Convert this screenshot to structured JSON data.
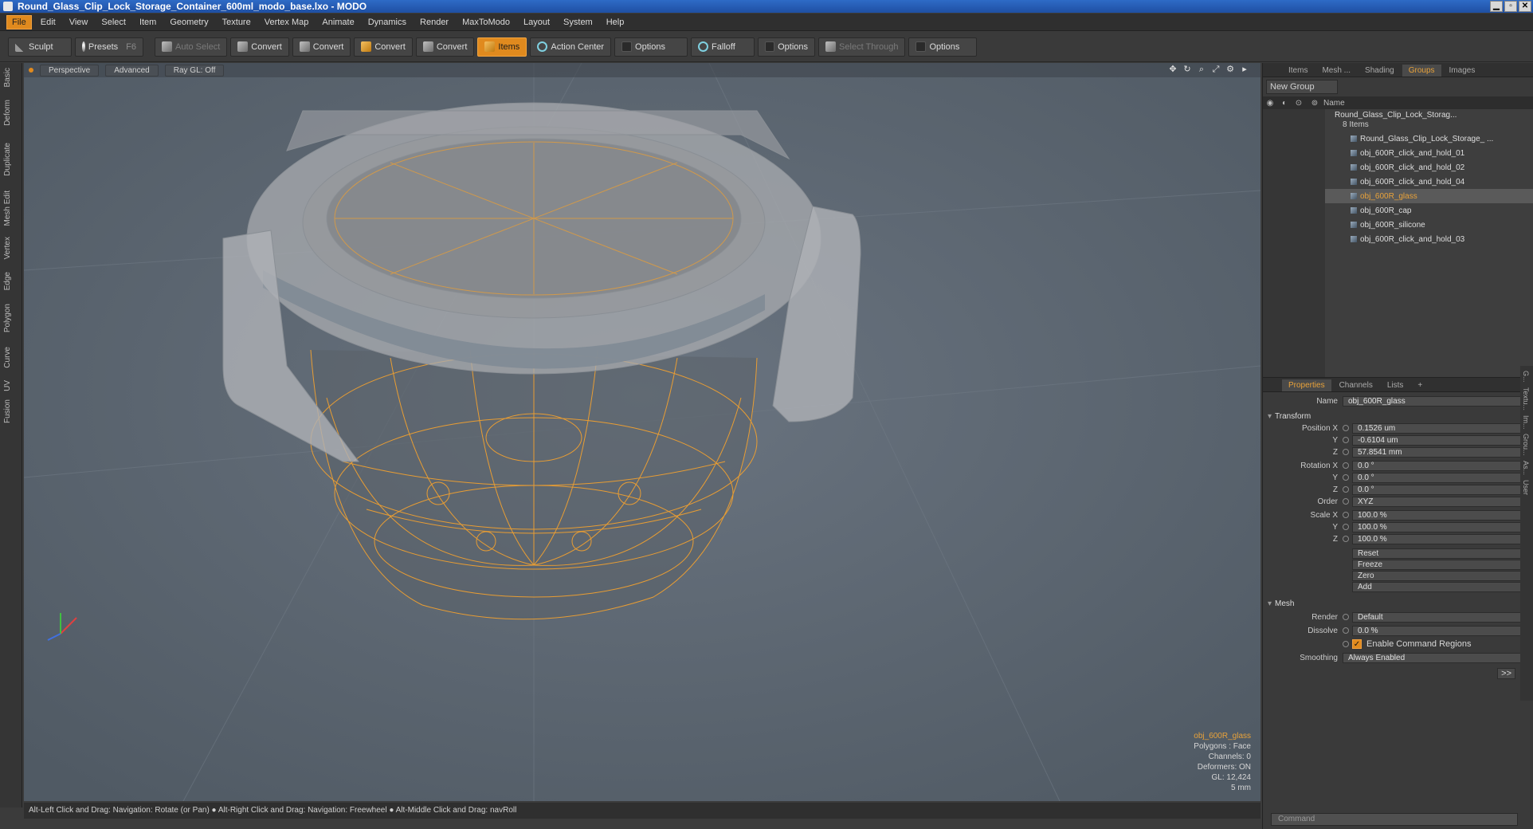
{
  "window": {
    "title": "Round_Glass_Clip_Lock_Storage_Container_600ml_modo_base.lxo - MODO",
    "controls": [
      "▁",
      "▫",
      "✕"
    ]
  },
  "menu": [
    "File",
    "Edit",
    "View",
    "Select",
    "Item",
    "Geometry",
    "Texture",
    "Vertex Map",
    "Animate",
    "Dynamics",
    "Render",
    "MaxToModo",
    "Layout",
    "System",
    "Help"
  ],
  "toolbar": {
    "sculpt": "Sculpt",
    "presets": "Presets",
    "presets_key": "F6",
    "auto_select": "Auto Select",
    "convert1": "Convert",
    "convert2": "Convert",
    "convert3": "Convert",
    "convert4": "Convert",
    "items": "Items",
    "action_center": "Action Center",
    "options1": "Options",
    "falloff": "Falloff",
    "options2": "Options",
    "select_through": "Select Through",
    "options3": "Options"
  },
  "left_tabs": [
    "Basic",
    "Deform",
    "Duplicate",
    "Mesh Edit",
    "Vertex",
    "Edge",
    "Polygon",
    "Curve",
    "UV",
    "Fusion"
  ],
  "viewport": {
    "view": "Perspective",
    "shading": "Advanced",
    "raygl": "Ray GL: Off",
    "info": {
      "selected": "obj_600R_glass",
      "polygons": "Polygons : Face",
      "channels": "Channels: 0",
      "deformers": "Deformers: ON",
      "gl": "GL: 12,424",
      "scale": "5 mm"
    },
    "mesh_color": "#f0a030",
    "background": "#5a6470"
  },
  "status": "Alt-Left Click and Drag: Navigation: Rotate (or Pan) ● Alt-Right Click and Drag: Navigation: Freewheel ● Alt-Middle Click and Drag: navRoll",
  "outliner": {
    "tabs": [
      "Items",
      "Mesh ...",
      "Shading",
      "Groups",
      "Images"
    ],
    "new_group": "New Group",
    "col_name": "Name",
    "group_name": "Round_Glass_Clip_Lock_Storag...",
    "group_count": "8 Items",
    "items": [
      "Round_Glass_Clip_Lock_Storage_ ...",
      "obj_600R_click_and_hold_01",
      "obj_600R_click_and_hold_02",
      "obj_600R_click_and_hold_04",
      "obj_600R_glass",
      "obj_600R_cap",
      "obj_600R_silicone",
      "obj_600R_click_and_hold_03"
    ]
  },
  "properties": {
    "tabs": [
      "Properties",
      "Channels",
      "Lists",
      "+"
    ],
    "name_label": "Name",
    "name_value": "obj_600R_glass",
    "transform": "Transform",
    "position_label": "Position X",
    "pos_x": "0.1526 um",
    "pos_y": "-0.6104 um",
    "pos_z": "57.8541 mm",
    "rotation_label": "Rotation X",
    "rot_x": "0.0 °",
    "rot_y": "0.0 °",
    "rot_z": "0.0 °",
    "order_label": "Order",
    "order": "XYZ",
    "scale_label": "Scale X",
    "scale_x": "100.0 %",
    "scale_y": "100.0 %",
    "scale_z": "100.0 %",
    "y": "Y",
    "z": "Z",
    "reset": "Reset",
    "freeze": "Freeze",
    "zero": "Zero",
    "add": "Add",
    "mesh": "Mesh",
    "render_label": "Render",
    "render": "Default",
    "dissolve_label": "Dissolve",
    "dissolve": "0.0 %",
    "enable_cmd": "Enable Command Regions",
    "smoothing_label": "Smoothing",
    "smoothing": "Always Enabled",
    "more": ">>"
  },
  "command": "Command"
}
